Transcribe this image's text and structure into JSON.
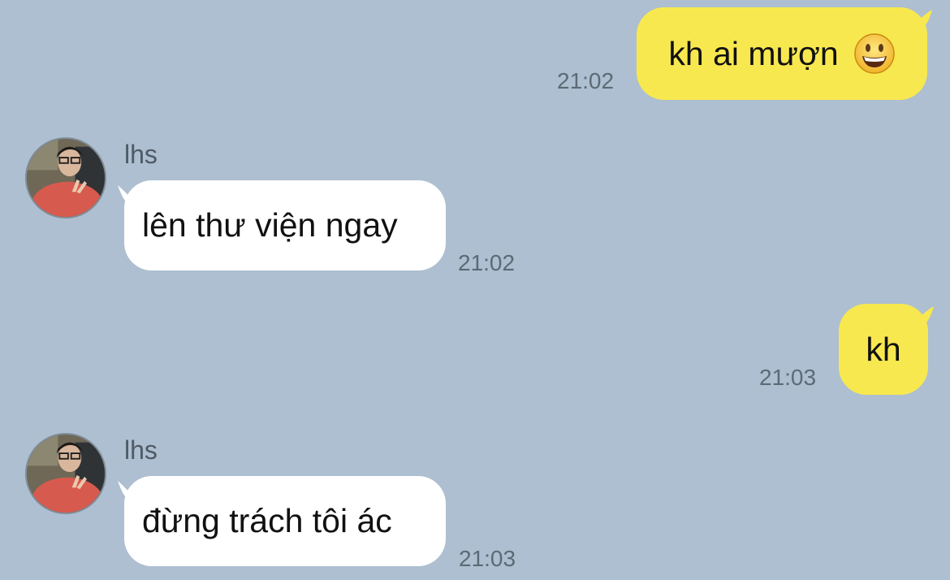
{
  "conversation": {
    "messages": [
      {
        "sender": "me",
        "text": "kh ai mượn",
        "emoji": "grinning-face-emoji",
        "time": "21:02"
      },
      {
        "sender": "lhs",
        "name": "lhs",
        "text": "lên thư viện ngay",
        "time": "21:02"
      },
      {
        "sender": "me",
        "text": "kh",
        "time": "21:03"
      },
      {
        "sender": "lhs",
        "name": "lhs",
        "text": "đừng trách tôi ác",
        "time": "21:03"
      }
    ]
  },
  "colors": {
    "background": "#adbfd0",
    "outgoing_bubble": "#f8e84f",
    "incoming_bubble": "#ffffff",
    "timestamp": "#5d6a75",
    "sender_name": "#4f5a65"
  }
}
